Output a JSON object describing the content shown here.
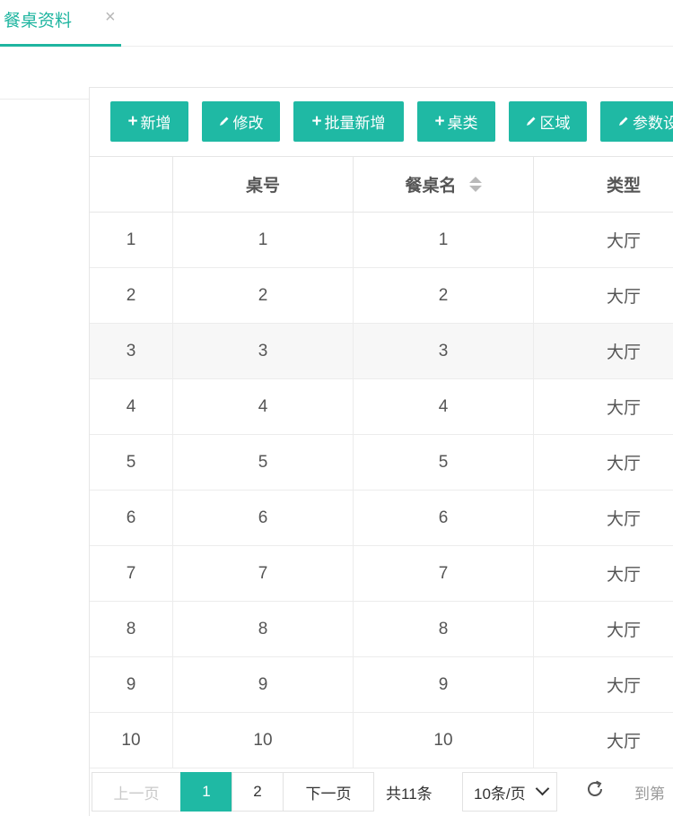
{
  "tab": {
    "title": "餐桌资料",
    "close_glyph": "×"
  },
  "toolbar": {
    "buttons": [
      {
        "label": "新增",
        "icon": "plus-icon"
      },
      {
        "label": "修改",
        "icon": "pencil-icon"
      },
      {
        "label": "批量新增",
        "icon": "plus-icon"
      },
      {
        "label": "桌类",
        "icon": "plus-icon"
      },
      {
        "label": "区域",
        "icon": "pencil-icon"
      },
      {
        "label": "参数设",
        "icon": "pencil-icon"
      }
    ]
  },
  "table": {
    "columns": [
      "",
      "桌号",
      "餐桌名",
      "类型"
    ],
    "rows": [
      [
        "1",
        "1",
        "1",
        "大厅"
      ],
      [
        "2",
        "2",
        "2",
        "大厅"
      ],
      [
        "3",
        "3",
        "3",
        "大厅"
      ],
      [
        "4",
        "4",
        "4",
        "大厅"
      ],
      [
        "5",
        "5",
        "5",
        "大厅"
      ],
      [
        "6",
        "6",
        "6",
        "大厅"
      ],
      [
        "7",
        "7",
        "7",
        "大厅"
      ],
      [
        "8",
        "8",
        "8",
        "大厅"
      ],
      [
        "9",
        "9",
        "9",
        "大厅"
      ],
      [
        "10",
        "10",
        "10",
        "大厅"
      ]
    ]
  },
  "pagination": {
    "prev": "上一页",
    "pages": [
      "1",
      "2"
    ],
    "current": "1",
    "next": "下一页",
    "total": "共11条",
    "page_size": "10条/页",
    "goto": "到第"
  },
  "colors": {
    "accent": "#1fb9a4",
    "tab_accent": "#1fb5a0"
  }
}
